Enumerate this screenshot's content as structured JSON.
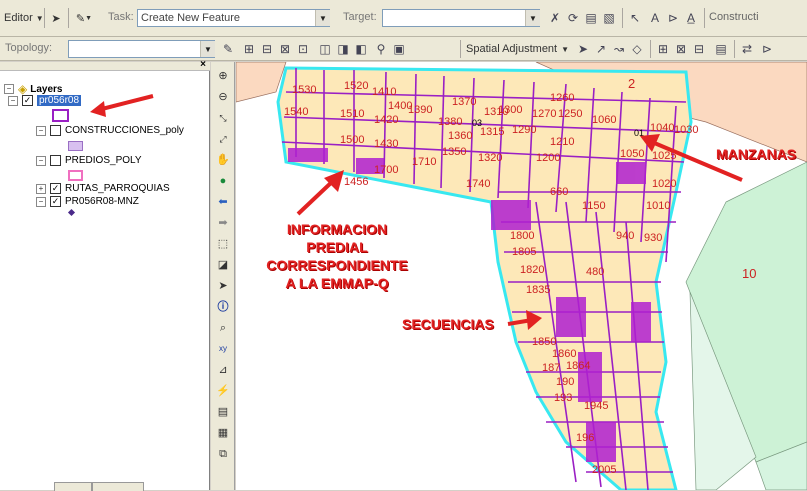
{
  "toolbar1": {
    "editor_label": "Editor",
    "task_label": "Task:",
    "task_value": "Create New Feature",
    "target_label": "Target:",
    "target_value": "",
    "construct_label": "Constructi"
  },
  "toolbar2": {
    "topology_label": "Topology:",
    "topology_value": "",
    "spatial_adjustment_label": "Spatial Adjustment"
  },
  "toc": {
    "root_label": "Layers",
    "layers": [
      {
        "name": "pr056r08",
        "checked": true,
        "expanded": true,
        "selected": true
      },
      {
        "name": "CONSTRUCCIONES_poly",
        "checked": false,
        "expanded": true
      },
      {
        "name": "PREDIOS_POLY",
        "checked": false,
        "expanded": true
      },
      {
        "name": "RUTAS_PARROQUIAS",
        "checked": true,
        "expanded": false
      },
      {
        "name": "PR056R08-MNZ",
        "checked": true,
        "expanded": true
      }
    ],
    "bottom_tabs": [
      "",
      ""
    ]
  },
  "map": {
    "zone_labels": [
      "2",
      "10"
    ],
    "parcel_labels": [
      "1530",
      "1520",
      "1410",
      "1400",
      "1390",
      "1370",
      "1380",
      "1310",
      "1300",
      "1260",
      "1270",
      "1250",
      "1060",
      "1540",
      "1510",
      "1420",
      "03",
      "1360",
      "1315",
      "1290",
      "1210",
      "01",
      "1040",
      "1030",
      "1500",
      "1430",
      "1350",
      "1320",
      "1200",
      "1050",
      "1025",
      "1710",
      "1700",
      "1456",
      "1740",
      "660",
      "1150",
      "1020",
      "1010",
      "930",
      "1800",
      "1805",
      "940",
      "1820",
      "480",
      "1835",
      "1850",
      "1860",
      "1864",
      "187",
      "190",
      "193",
      "1945",
      "196",
      "2005"
    ],
    "annotations": {
      "info_predial": "INFORMACION\nPREDIAL\nCORRESPONDIENTE\nA LA EMMAP-Q",
      "secuencias": "SECUENCIAS",
      "manzanas": "MANZANAS"
    },
    "colors": {
      "parcel_fill": "#fde8b8",
      "parcel_stroke": "#9a1fc4",
      "block_outline": "#38e8f0",
      "zone_peach": "#fbd9c0",
      "zone_green": "#cdf2d6",
      "annotation_red": "#e22222",
      "label_red": "#cc2222"
    }
  }
}
